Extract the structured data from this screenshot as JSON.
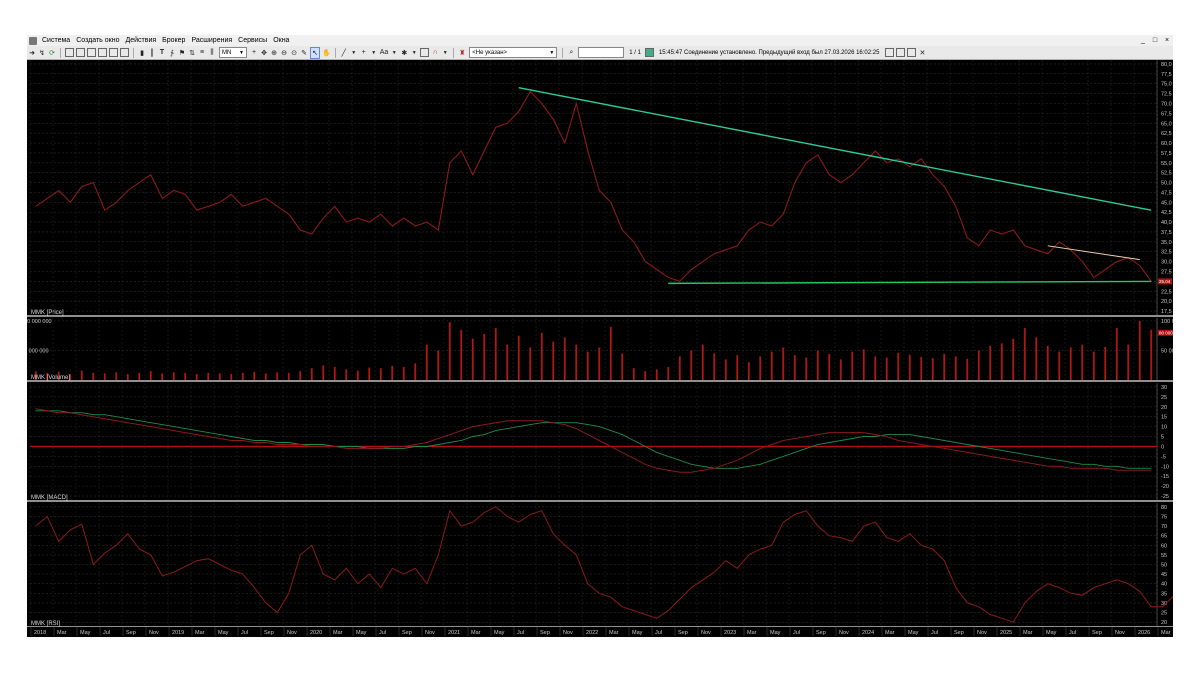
{
  "menu": {
    "items": [
      "Система",
      "Создать окно",
      "Действия",
      "Брокер",
      "Расширения",
      "Сервисы",
      "Окна"
    ]
  },
  "toolbar": {
    "timeframe": "MN",
    "font_label": "Aa",
    "account": "<Не указан>",
    "page": "1 / 1",
    "status": "15:45:47  Соединение установлено. Предыдущий вход был 27.03.2026 16:02:25"
  },
  "panes": {
    "price": {
      "label": "MMK [Price]",
      "ticks": [
        "80,0",
        "77,5",
        "75,0",
        "72,5",
        "70,0",
        "67,5",
        "65,0",
        "62,5",
        "60,0",
        "57,5",
        "55,0",
        "52,5",
        "50,0",
        "47,5",
        "45,0",
        "42,5",
        "40,0",
        "37,5",
        "35,0",
        "32,5",
        "30,0",
        "27,5",
        "25,0",
        "22,5",
        "20,0",
        "17,5"
      ],
      "last_label": "25,04"
    },
    "volume": {
      "label": "MMK [Volume]",
      "ticks_left": [
        "100 000 000",
        "50 000 000"
      ],
      "ticks_right": [
        "100 000 00",
        "50 000 000"
      ],
      "last_label": "80 000 00"
    },
    "macd": {
      "label": "MMK [MACD]",
      "ticks": [
        "30",
        "25",
        "20",
        "15",
        "10",
        "5",
        "0",
        "-5",
        "-10",
        "-15",
        "-20",
        "-25"
      ]
    },
    "rsi": {
      "label": "MMK [RSI]",
      "ticks": [
        "80",
        "75",
        "70",
        "65",
        "60",
        "55",
        "50",
        "45",
        "40",
        "35",
        "30",
        "25",
        "20"
      ]
    }
  },
  "time_axis": [
    "2018",
    "Mar",
    "May",
    "Jul",
    "Sep",
    "Nov",
    "2019",
    "Mar",
    "May",
    "Jul",
    "Sep",
    "Nov",
    "2020",
    "Mar",
    "May",
    "Jul",
    "Sep",
    "Nov",
    "2021",
    "Mar",
    "May",
    "Jul",
    "Sep",
    "Nov",
    "2022",
    "Mar",
    "May",
    "Jul",
    "Sep",
    "Nov",
    "2023",
    "Mar",
    "May",
    "Jul",
    "Sep",
    "Nov",
    "2024",
    "Mar",
    "May",
    "Jul",
    "Sep",
    "Nov",
    "2025",
    "Mar",
    "May",
    "Jul",
    "Sep",
    "Nov",
    "2026",
    "Mar"
  ],
  "colors": {
    "price": "#8b1a1a",
    "trend": "#2fc89a",
    "support": "#28c860",
    "short_trend": "#f0d8a8",
    "macd_signal": "#1f8a4a",
    "zero_line": "#b01010",
    "volume": "#b01818",
    "grid": "#2a2a2a"
  },
  "chart_data": {
    "type": "line",
    "x_start": "2018-01",
    "x_end": "2026-03",
    "price": [
      44,
      46,
      48,
      45,
      49,
      50,
      43,
      45,
      48,
      50,
      52,
      46,
      48,
      47,
      43,
      44,
      45,
      47,
      44,
      45,
      46,
      44,
      42,
      38,
      37,
      41,
      44,
      40,
      41,
      40,
      42,
      39,
      41,
      39,
      40,
      38,
      55,
      58,
      52,
      58,
      64,
      65,
      68,
      73,
      70,
      66,
      60,
      70,
      58,
      48,
      45,
      38,
      35,
      30,
      28,
      26,
      25,
      28,
      30,
      32,
      33,
      34,
      38,
      40,
      39,
      42,
      50,
      55,
      57,
      52,
      50,
      52,
      55,
      58,
      55,
      56,
      54,
      56,
      52,
      49,
      44,
      36,
      34,
      38,
      37,
      38,
      34,
      33,
      32,
      35,
      33,
      30,
      26,
      28,
      30,
      31,
      29,
      25
    ],
    "volume_millions": [
      15,
      12,
      14,
      10,
      16,
      12,
      11,
      13,
      10,
      12,
      15,
      11,
      13,
      12,
      10,
      12,
      11,
      10,
      12,
      14,
      11,
      13,
      12,
      15,
      20,
      25,
      22,
      18,
      16,
      21,
      20,
      24,
      22,
      28,
      60,
      50,
      98,
      85,
      70,
      78,
      88,
      60,
      75,
      55,
      80,
      65,
      72,
      60,
      48,
      55,
      90,
      45,
      20,
      15,
      18,
      22,
      40,
      50,
      60,
      45,
      35,
      42,
      30,
      40,
      48,
      55,
      42,
      38,
      50,
      44,
      35,
      48,
      52,
      40,
      38,
      46,
      43,
      39,
      37,
      44,
      40,
      36,
      50,
      58,
      62,
      70,
      88,
      72,
      58,
      48,
      55,
      60,
      48,
      56,
      88,
      60,
      100,
      85
    ],
    "macd": [
      19,
      18,
      17,
      17,
      16,
      15,
      14,
      13,
      12,
      11,
      10,
      9,
      8,
      7,
      6,
      5,
      4,
      3,
      3,
      2,
      2,
      1,
      1,
      1,
      0,
      0,
      0,
      -1,
      -1,
      -1,
      -1,
      0,
      0,
      1,
      2,
      4,
      6,
      8,
      10,
      11,
      12,
      13,
      13,
      13,
      13,
      12,
      11,
      9,
      6,
      3,
      0,
      -3,
      -6,
      -9,
      -11,
      -12,
      -13,
      -13,
      -12,
      -11,
      -9,
      -7,
      -4,
      -1,
      1,
      3,
      4,
      5,
      6,
      7,
      7,
      7,
      7,
      6,
      5,
      3,
      2,
      1,
      0,
      -1,
      -2,
      -3,
      -4,
      -5,
      -6,
      -7,
      -8,
      -9,
      -10,
      -10,
      -11,
      -11,
      -11,
      -11,
      -12,
      -12,
      -12,
      -12
    ],
    "signal": [
      18,
      18,
      18,
      17,
      17,
      16,
      16,
      15,
      14,
      13,
      12,
      11,
      10,
      9,
      8,
      7,
      6,
      5,
      4,
      3,
      3,
      2,
      2,
      1,
      1,
      1,
      0,
      0,
      0,
      -1,
      -1,
      -1,
      -1,
      0,
      0,
      1,
      2,
      3,
      5,
      6,
      8,
      9,
      10,
      11,
      12,
      12,
      12,
      12,
      11,
      10,
      8,
      6,
      3,
      0,
      -3,
      -5,
      -7,
      -9,
      -10,
      -11,
      -11,
      -11,
      -10,
      -9,
      -7,
      -5,
      -3,
      -1,
      1,
      2,
      3,
      4,
      5,
      5,
      6,
      6,
      6,
      5,
      4,
      3,
      2,
      1,
      0,
      -1,
      -2,
      -3,
      -4,
      -5,
      -6,
      -7,
      -8,
      -9,
      -9,
      -10,
      -10,
      -11,
      -11,
      -11
    ],
    "rsi": [
      70,
      75,
      62,
      68,
      71,
      50,
      56,
      60,
      66,
      58,
      55,
      44,
      46,
      49,
      52,
      53,
      50,
      47,
      45,
      38,
      30,
      25,
      35,
      55,
      60,
      45,
      42,
      48,
      40,
      45,
      38,
      48,
      45,
      48,
      40,
      55,
      78,
      70,
      72,
      77,
      80,
      75,
      72,
      76,
      78,
      66,
      60,
      55,
      40,
      35,
      33,
      28,
      26,
      24,
      22,
      26,
      32,
      38,
      42,
      46,
      52,
      48,
      55,
      58,
      60,
      72,
      76,
      78,
      70,
      65,
      64,
      62,
      70,
      72,
      64,
      62,
      66,
      60,
      58,
      52,
      38,
      30,
      28,
      24,
      22,
      20,
      30,
      36,
      40,
      38,
      35,
      34,
      38,
      40,
      42,
      40,
      36,
      28,
      28,
      34,
      40,
      42,
      44,
      45,
      32
    ]
  }
}
